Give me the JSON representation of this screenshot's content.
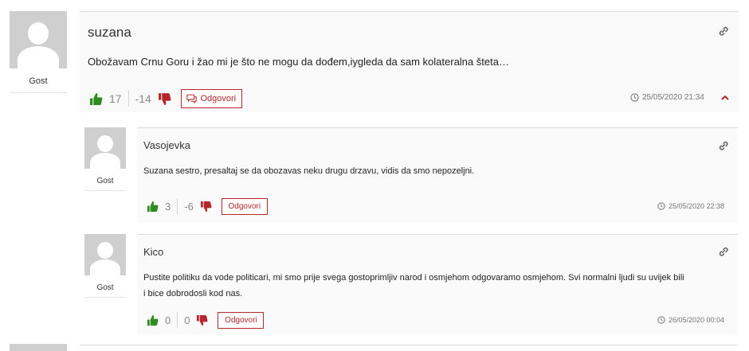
{
  "comments": [
    {
      "author": "suzana",
      "role": "Gost",
      "text": "Obožavam Crnu Goru i žao mi je što ne mogu da dođem,iygleda da sam kolateralna šteta…",
      "likes": "17",
      "dislikes": "-14",
      "reply_label": "Odgovori",
      "date": "25/05/2020 21:34",
      "toggle_icon": "chevron-up-icon"
    },
    {
      "author": "Vasojevka",
      "role": "Gost",
      "text": "Suzana sestro, presaltaj se da obozavas neku drugu drzavu, vidis da smo nepozeljni.",
      "likes": "3",
      "dislikes": "-6",
      "reply_label": "Odgovori",
      "date": "25/05/2020 22:38"
    },
    {
      "author": "Kico",
      "role": "Gost",
      "text_line1": "Pustite politiku da vode politicari, mi smo prije svega gostoprimljiv narod i osmjehom odgovaramo osmjehom. Svi normalni ljudi su uvijek bili",
      "text_line2": "i bice dobrodosli kod nas.",
      "likes": "0",
      "dislikes": "0",
      "reply_label": "Odgovori",
      "date": "26/05/2020 00:04"
    }
  ],
  "colors": {
    "like": "#2e8b1f",
    "dislike": "#b5272d",
    "accent": "#b5272d"
  },
  "icons": [
    "thumbs-up-icon",
    "thumbs-down-icon",
    "comment-bubble-icon",
    "clock-icon",
    "link-icon",
    "chevron-up-icon"
  ]
}
